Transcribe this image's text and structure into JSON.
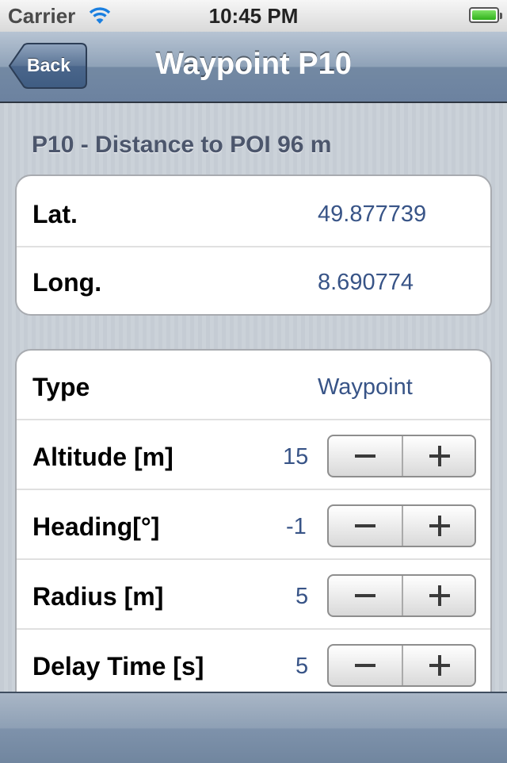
{
  "status_bar": {
    "carrier": "Carrier",
    "time": "10:45 PM",
    "wifi_icon": "wifi-icon",
    "battery_icon": "battery-icon"
  },
  "nav": {
    "back_label": "Back",
    "title": "Waypoint P10"
  },
  "section_header": "P10 - Distance to POI 96 m",
  "location": {
    "lat_label": "Lat.",
    "lat_value": "49.877739",
    "long_label": "Long.",
    "long_value": "8.690774"
  },
  "settings": {
    "type_label": "Type",
    "type_value": "Waypoint",
    "altitude_label": "Altitude [m]",
    "altitude_value": "15",
    "heading_label": "Heading[°]",
    "heading_value": "-1",
    "radius_label": "Radius [m]",
    "radius_value": "5",
    "delay_label": "Delay Time [s]",
    "delay_value": "5"
  },
  "colors": {
    "value_text": "#385487",
    "nav_bar": "#6c82a0",
    "background": "#c5ccd4"
  }
}
